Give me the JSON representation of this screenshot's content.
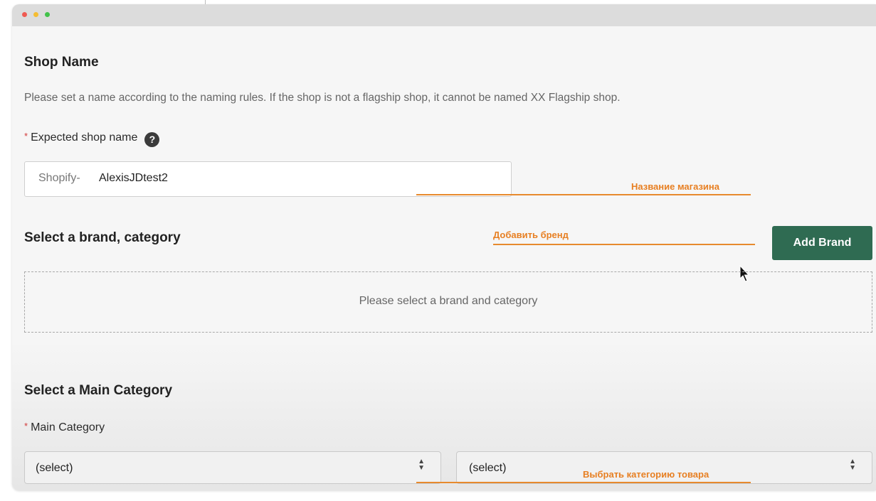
{
  "shop_name_section": {
    "title": "Shop Name",
    "description": "Please set a name according to the naming rules. If the shop is not a flagship shop, it cannot be named XX Flagship shop.",
    "required_mark": "*",
    "field_label": "Expected shop name",
    "help_icon": "?",
    "input_prefix": "Shopify-",
    "input_value": "AlexisJDtest2"
  },
  "brand_section": {
    "title": "Select a brand, category",
    "add_brand_label": "Add Brand",
    "empty_text": "Please select a brand and category"
  },
  "main_category_section": {
    "title": "Select a Main Category",
    "required_mark": "*",
    "field_label": "Main Category",
    "select1_value": "(select)",
    "select2_value": "(select)"
  },
  "annotations": {
    "shop_name": "Название магазина",
    "add_brand": "Добавить бренд",
    "select_category": "Выбрать категорию товара"
  },
  "colors": {
    "accent_button": "#2f6b52",
    "annotation_orange": "#e77f22",
    "required_red": "#d23b3b"
  },
  "icons": {
    "help": "question-circle-icon",
    "select_arrows": "up-down-arrows-icon",
    "cursor": "mouse-pointer-icon"
  }
}
